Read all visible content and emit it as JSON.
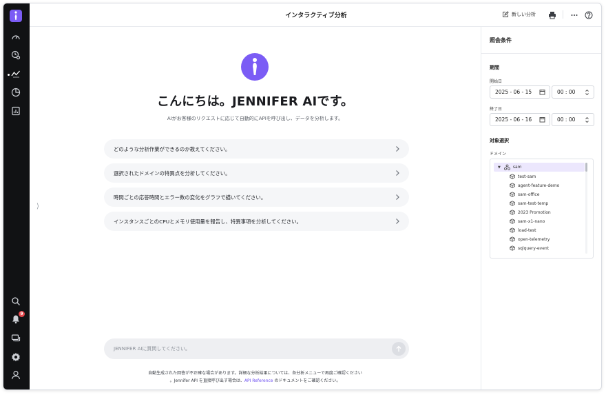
{
  "header": {
    "title": "インタラクティブ分析",
    "new_analysis_label": "新しい分析"
  },
  "hero": {
    "title": "こんにちは。JENNIFER AIです。",
    "subtitle": "AIがお客様のリクエストに応じて自動的にAPIを呼び出し、データを分析します。"
  },
  "suggestions": [
    "どのような分析作業ができるのか教えてください。",
    "選択されたドメインの特異点を分析してください。",
    "時間ごとの応答時間とエラー数の変化をグラフで描いてください。",
    "インスタンスごとのCPUとメモリ使用量を報告し、特異事項を分析してください。"
  ],
  "chat": {
    "placeholder": "JENNIFER AIに質問してください。"
  },
  "disclaimer": {
    "line1": "自動生成された回答が不正確な場合があります。詳細な分析結果については、各分析メニューで再度ご確認ください",
    "line2_prefix": "。Jennifer API を直接呼び出す場合は、",
    "link": "API Reference",
    "line2_suffix": " のドキュメントをご確認ください。"
  },
  "rail": {
    "notification_count": "9"
  },
  "panel": {
    "title": "照会条件",
    "period_title": "期間",
    "start_label": "開始日",
    "start_date": "2025 - 06 - 15",
    "start_time": "00 : 00",
    "end_label": "終了日",
    "end_date": "2025 - 06 - 16",
    "end_time": "00 : 00",
    "target_title": "対象選択",
    "domain_label": "ドメイン",
    "tree_root": "sam",
    "tree_items": [
      "test-sam",
      "agent-feature-demo",
      "sam-office",
      "sam-test-temp",
      "2023 Promotion",
      "sam-x1-nano",
      "load-test",
      "open-telemetry",
      "sqlquery-event"
    ]
  },
  "colors": {
    "accent": "#7b5cf5",
    "rail": "#111214",
    "badge": "#e5484d"
  },
  "icons": {
    "rail": [
      "logo-icon",
      "dashboard-icon",
      "realtime-icon",
      "analysis-icon",
      "statistics-icon",
      "report-icon",
      "search-icon",
      "bell-icon",
      "chat-icon",
      "settings-icon",
      "user-icon"
    ],
    "header": [
      "edit-icon",
      "print-icon",
      "more-icon",
      "help-icon"
    ]
  }
}
